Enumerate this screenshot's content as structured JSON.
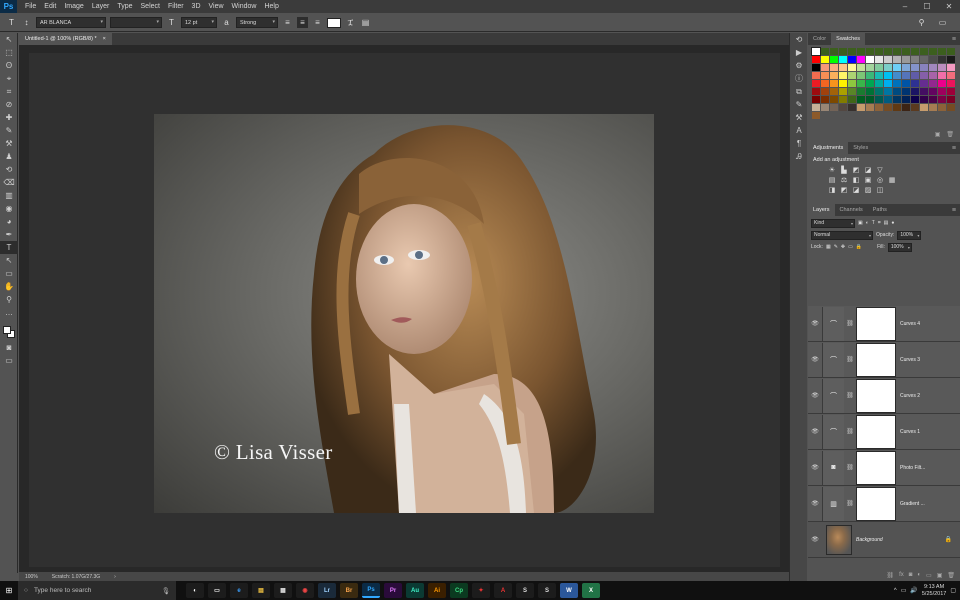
{
  "app": {
    "logo": "Ps"
  },
  "menu": [
    "File",
    "Edit",
    "Image",
    "Layer",
    "Type",
    "Select",
    "Filter",
    "3D",
    "View",
    "Window",
    "Help"
  ],
  "window_controls": [
    "–",
    "☐",
    "✕"
  ],
  "options": {
    "font_family": "AR BLANCA",
    "font_style": "",
    "font_size": "12 pt",
    "antialias_label": "a",
    "antialias": "Strong"
  },
  "document": {
    "tab_title": "Untitled-1 @ 100% (RGB/8) *",
    "zoom": "100%",
    "scratch": "Scratch: 1.07G/27.3G",
    "watermark": "© Lisa Visser"
  },
  "tools": [
    "↖",
    "⬚",
    "ʘ",
    "⌖",
    "⌗",
    "⊘",
    "✚",
    "✎",
    "⚒",
    "♟",
    "⟲",
    "⌫",
    "▥",
    "◉",
    "◕",
    "✒",
    "T",
    "↖",
    "▭",
    "✋",
    "⚲",
    "…"
  ],
  "swatches_tabs": [
    "Color",
    "Swatches"
  ],
  "swatch_colors": [
    "#ffffff",
    "#3c5f1e",
    "#3c5f1e",
    "#3c5f1e",
    "#3c5f1e",
    "#3c5f1e",
    "#3c5f1e",
    "#3c5f1e",
    "#3c5f1e",
    "#3c5f1e",
    "#3c5f1e",
    "#3c5f1e",
    "#3c5f1e",
    "#3c5f1e",
    "#3c5f1e",
    "#3c5f1e",
    "#ff0000",
    "#ffff00",
    "#00ff00",
    "#00ffff",
    "#0000ff",
    "#ff00ff",
    "#ffffff",
    "#e6e6e6",
    "#cccccc",
    "#b3b3b3",
    "#999999",
    "#808080",
    "#666666",
    "#4d4d4d",
    "#333333",
    "#1a1a1a",
    "#000000",
    "#f7977a",
    "#f9ad81",
    "#fdc68a",
    "#fff79a",
    "#c4df9b",
    "#a2d39c",
    "#82ca9d",
    "#7bcdc8",
    "#6ecff6",
    "#7ea7d8",
    "#8493ca",
    "#8882be",
    "#a187be",
    "#bc8dbf",
    "#f49ac2",
    "#f26c4f",
    "#f68e55",
    "#fbaf5c",
    "#fff467",
    "#acd372",
    "#7cc576",
    "#3bb878",
    "#1abbb4",
    "#00bff3",
    "#438ccb",
    "#5574b9",
    "#605ca8",
    "#855fa8",
    "#a763a8",
    "#f06ea9",
    "#f26d7d",
    "#ed1c24",
    "#f26522",
    "#f7941d",
    "#fff200",
    "#8dc73f",
    "#39b54a",
    "#00a651",
    "#00a99d",
    "#00aeef",
    "#0072bc",
    "#0054a6",
    "#2e3192",
    "#662d91",
    "#92278f",
    "#ec008c",
    "#ed145b",
    "#9e0b0f",
    "#a0410d",
    "#a36209",
    "#aba000",
    "#598527",
    "#1a7b30",
    "#007236",
    "#00746b",
    "#0076a3",
    "#004b80",
    "#003471",
    "#1b1464",
    "#440e62",
    "#630460",
    "#9e005d",
    "#9e0039",
    "#790000",
    "#7b2e00",
    "#7d4900",
    "#827b00",
    "#406618",
    "#005e20",
    "#005826",
    "#005952",
    "#005b7f",
    "#003663",
    "#002157",
    "#0d004c",
    "#32004b",
    "#4b0049",
    "#7b0046",
    "#7a0026",
    "#c7b299",
    "#998675",
    "#736357",
    "#534741",
    "#37302d",
    "#c69c6d",
    "#a67c52",
    "#8c6239",
    "#754c24",
    "#603913",
    "#3c2415",
    "#5b3a1f",
    "#c69c6d",
    "#a67c52",
    "#8c6239",
    "#754c24",
    "#8c5a2a"
  ],
  "adjustments": {
    "tabs": [
      "Adjustments",
      "Styles"
    ],
    "title": "Add an adjustment",
    "row1": [
      "☀",
      "▙",
      "◩",
      "◪",
      "▽"
    ],
    "row2": [
      "▤",
      "⚖",
      "◧",
      "▣",
      "◎",
      "▦"
    ],
    "row3": [
      "◨",
      "◩",
      "◪",
      "▨",
      "◫"
    ]
  },
  "layers": {
    "tabs": [
      "Layers",
      "Channels",
      "Paths"
    ],
    "filter": "Kind",
    "blend": "Normal",
    "opacity_label": "Opacity:",
    "opacity": "100%",
    "lock_label": "Lock:",
    "fill_label": "Fill:",
    "fill": "100%",
    "items": [
      {
        "name": "Curves 4",
        "icon": "⌒"
      },
      {
        "name": "Curves 3",
        "icon": "⌒"
      },
      {
        "name": "Curves 2",
        "icon": "⌒"
      },
      {
        "name": "Curves 1",
        "icon": "⌒"
      },
      {
        "name": "Photo Filt...",
        "icon": "◙"
      },
      {
        "name": "Gradient ...",
        "icon": "▥"
      }
    ],
    "background": "Background"
  },
  "taskbar": {
    "search": "Type here to search",
    "apps": [
      {
        "label": "◐",
        "bg": "#1c1c1c",
        "fg": "#fff"
      },
      {
        "label": "▭",
        "bg": "#1c1c1c",
        "fg": "#fff"
      },
      {
        "label": "e",
        "bg": "#1c1c1c",
        "fg": "#3aa0ff"
      },
      {
        "label": "▤",
        "bg": "#1c1c1c",
        "fg": "#f4c542"
      },
      {
        "label": "▦",
        "bg": "#1c1c1c",
        "fg": "#ddd"
      },
      {
        "label": "◉",
        "bg": "#1c1c1c",
        "fg": "#e44"
      },
      {
        "label": "Lr",
        "bg": "#1a2a3a",
        "fg": "#9fd3ff"
      },
      {
        "label": "Br",
        "bg": "#3a2a10",
        "fg": "#f7a34b"
      },
      {
        "label": "Ps",
        "bg": "#0b2b46",
        "fg": "#31a8ff"
      },
      {
        "label": "Pr",
        "bg": "#2a0b3a",
        "fg": "#e27bff"
      },
      {
        "label": "Au",
        "bg": "#0b3a33",
        "fg": "#3ff2c9"
      },
      {
        "label": "Ai",
        "bg": "#3a1f00",
        "fg": "#ff9a00"
      },
      {
        "label": "Cp",
        "bg": "#0b3a20",
        "fg": "#3ddc84"
      },
      {
        "label": "✦",
        "bg": "#1c1c1c",
        "fg": "#e33"
      },
      {
        "label": "A",
        "bg": "#1c1c1c",
        "fg": "#e33"
      },
      {
        "label": "S",
        "bg": "#1c1c1c",
        "fg": "#ddd"
      },
      {
        "label": "S",
        "bg": "#1c1c1c",
        "fg": "#ddd"
      },
      {
        "label": "W",
        "bg": "#2b579a",
        "fg": "#fff"
      },
      {
        "label": "X",
        "bg": "#217346",
        "fg": "#fff"
      }
    ],
    "time": "9:13 AM",
    "date": "5/25/2017"
  }
}
